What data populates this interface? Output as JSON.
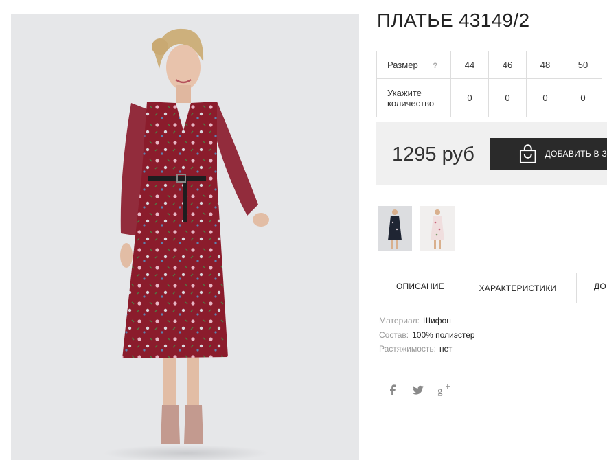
{
  "product": {
    "title": "ПЛАТЬЕ 43149/2",
    "main_image_alt": "Woman in a long-sleeve burgundy floral chiffon midi dress with a black belt"
  },
  "sizes": {
    "size_label": "Размер",
    "help_mark": "?",
    "size_values": [
      "44",
      "46",
      "48",
      "50"
    ],
    "qty_label_line1": "Укажите",
    "qty_label_line2": "количество",
    "qty_values": [
      "0",
      "0",
      "0",
      "0"
    ]
  },
  "buy": {
    "price": "1295 руб",
    "add_to_cart_label": "ДОБАВИТЬ В З",
    "cart_icon": "shopping-bag-icon"
  },
  "thumbnails": [
    {
      "name": "navy-floral-dress"
    },
    {
      "name": "white-floral-dress"
    }
  ],
  "tabs": {
    "description": "ОПИСАНИЕ",
    "characteristics": "ХАРАКТЕРИСТИКИ",
    "delivery": "ДО"
  },
  "specs": [
    {
      "key": "Материал:",
      "value": "Шифон"
    },
    {
      "key": "Состав:",
      "value": "100% полиэстер"
    },
    {
      "key": "Растяжимость:",
      "value": "нет"
    }
  ],
  "social": [
    "facebook-icon",
    "twitter-icon",
    "google-plus-icon"
  ],
  "colors": {
    "dress": "#8b1c2c",
    "button": "#2a2a2a",
    "buy_box": "#f0f0f0",
    "photo_bg": "#e6e7e9"
  }
}
